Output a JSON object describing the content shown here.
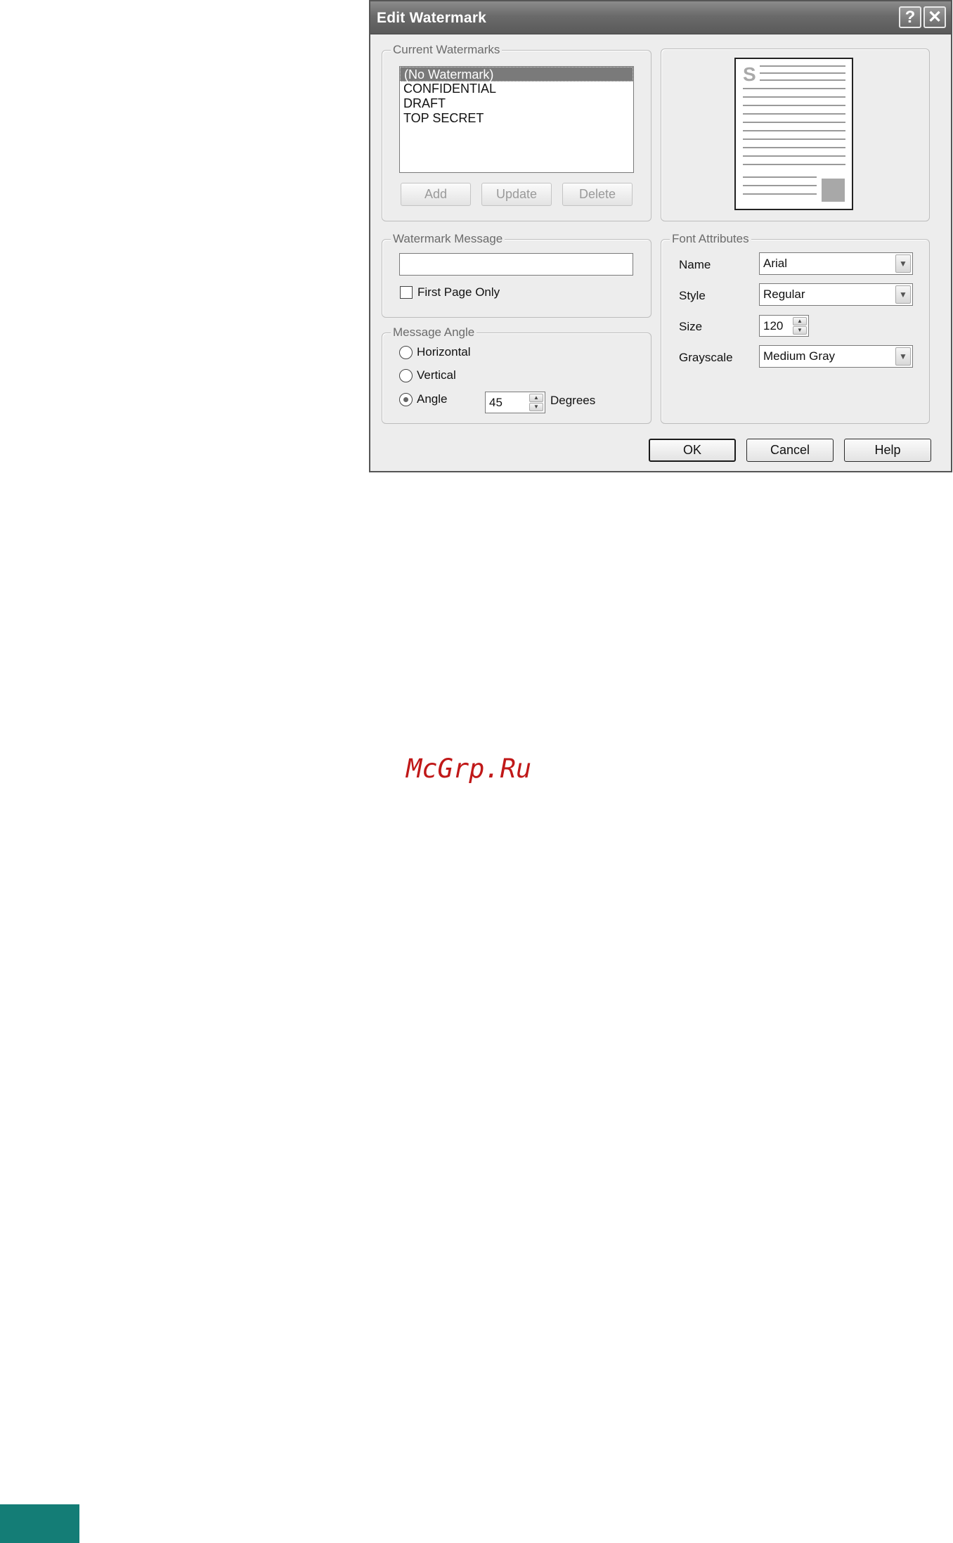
{
  "dialog": {
    "title": "Edit Watermark",
    "help_button": "?",
    "close_button": "✕"
  },
  "current_watermarks": {
    "label": "Current Watermarks",
    "items": [
      "(No Watermark)",
      "CONFIDENTIAL",
      "DRAFT",
      "TOP SECRET"
    ],
    "selected_index": 0,
    "add_label": "Add",
    "update_label": "Update",
    "delete_label": "Delete"
  },
  "preview": {
    "letter": "S"
  },
  "watermark_message": {
    "label": "Watermark Message",
    "value": "",
    "first_page_only_label": "First Page Only",
    "first_page_only_checked": false
  },
  "message_angle": {
    "label": "Message Angle",
    "horizontal_label": "Horizontal",
    "vertical_label": "Vertical",
    "angle_label": "Angle",
    "selected": "Angle",
    "angle_value": "45",
    "degrees_label": "Degrees"
  },
  "font_attributes": {
    "label": "Font Attributes",
    "name_label": "Name",
    "name_value": "Arial",
    "style_label": "Style",
    "style_value": "Regular",
    "size_label": "Size",
    "size_value": "120",
    "grayscale_label": "Grayscale",
    "grayscale_value": "Medium Gray"
  },
  "buttons": {
    "ok": "OK",
    "cancel": "Cancel",
    "help": "Help"
  },
  "page": {
    "site_watermark": "McGrp.Ru",
    "accent_color": "#147d76"
  }
}
